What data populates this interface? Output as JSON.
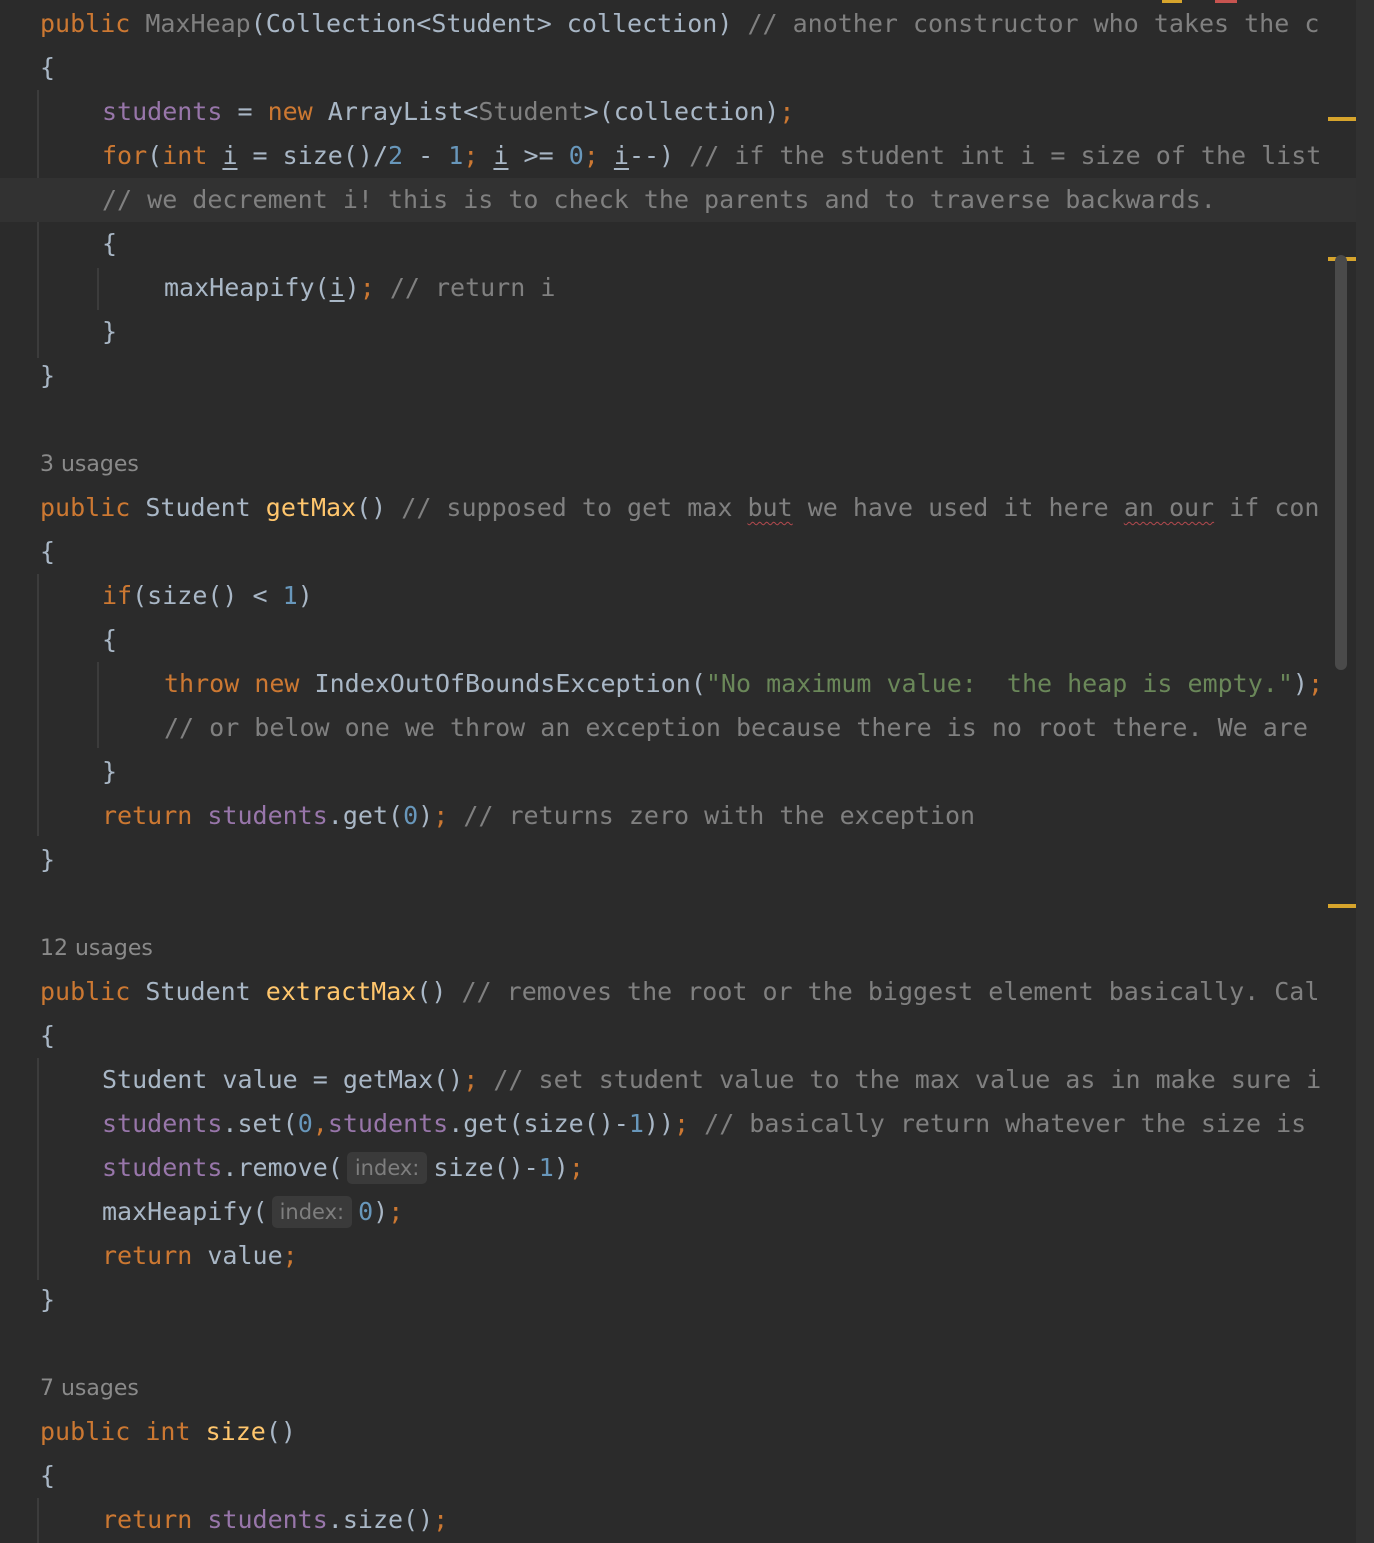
{
  "editor": {
    "colors": {
      "background": "#2b2b2b",
      "keyword": "#cc7832",
      "field": "#9876aa",
      "method": "#ffc66d",
      "number": "#6897bb",
      "string": "#6a8759",
      "comment": "#808080",
      "text": "#a9b7c6",
      "marker": "#d6a42c"
    },
    "usages": {
      "get_max": "3 usages",
      "extract_max": "12 usages",
      "size": "7 usages"
    },
    "hints": {
      "index": "index:"
    },
    "lines": {
      "l1": {
        "public": "public",
        "name": "MaxHeap",
        "params": "(Collection<Student> collection)",
        "comment": "// another constructor who takes the c"
      },
      "l2": {
        "brace": "{"
      },
      "l3": {
        "students": "students",
        "eq": " = ",
        "new": "new",
        "type": " ArrayList<",
        "generic": "Student",
        "rest": ">(collection)",
        "semi": ";"
      },
      "l4": {
        "for": "for",
        "open": "(",
        "int": "int",
        "i1": "i",
        "p1": " = size()/",
        "n2": "2",
        "p2": " - ",
        "n1": "1",
        "s1": ";",
        "i2": "i",
        "p3": " >= ",
        "n0": "0",
        "s2": ";",
        "i3": "i",
        "p4": "--) ",
        "comment": "// if the student int i = size of the list"
      },
      "l5": {
        "comment": "// we decrement i! this is to check the parents and to traverse backwards."
      },
      "l6": {
        "brace": "{"
      },
      "l7": {
        "call": "maxHeapify(",
        "i": "i",
        "close": ")",
        "semi": ";",
        "comment": "// return i"
      },
      "l8": {
        "brace": "}"
      },
      "l9": {
        "brace": "}"
      },
      "l10": {
        "public": "public",
        "type": "Student",
        "name": "getMax",
        "parens": "()",
        "c_a": "// supposed to get max",
        "c_but": "but",
        "c_b": "we have used it here",
        "c_anour": "an our",
        "c_c": "if con"
      },
      "l11": {
        "brace": "{"
      },
      "l12": {
        "if": "if",
        "p1": "(size() < ",
        "n1": "1",
        "p2": ")"
      },
      "l13": {
        "brace": "{"
      },
      "l14": {
        "throw": "throw",
        "new": "new",
        "cls": " IndexOutOfBoundsException(",
        "str": "\"No maximum value:  the heap is empty.\"",
        "close": ")",
        "semi": ";"
      },
      "l15": {
        "comment": "// or below one we throw an exception because there is no root there. We are"
      },
      "l16": {
        "brace": "}"
      },
      "l17": {
        "return": "return",
        "students": "students",
        "call": ".get(",
        "n0": "0",
        "close": ")",
        "semi": ";",
        "comment": "// returns zero with the exception"
      },
      "l18": {
        "brace": "}"
      },
      "l19": {
        "public": "public",
        "type": "Student",
        "name": "extractMax",
        "parens": "()",
        "comment": "// removes the root or the biggest element basically. Cal"
      },
      "l20": {
        "brace": "{"
      },
      "l21": {
        "decl": "Student value = getMax()",
        "semi": ";",
        "comment": "// set student value to the max value as in make sure i"
      },
      "l22": {
        "students1": "students",
        "set": ".set(",
        "n0": "0",
        "comma": ",",
        "students2": "students",
        "get": ".get(size()-",
        "n1": "1",
        "close": "))",
        "semi": ";",
        "comment": "// basically return whatever the size is"
      },
      "l23": {
        "students": "students",
        "call": ".remove(",
        "arg": "size()-",
        "n1": "1",
        "close": ")",
        "semi": ";"
      },
      "l24": {
        "call": "maxHeapify(",
        "n0": "0",
        "close": ")",
        "semi": ";"
      },
      "l25": {
        "return": "return",
        "value": " value",
        "semi": ";"
      },
      "l26": {
        "brace": "}"
      },
      "l27": {
        "public": "public",
        "int": "int",
        "name": "size",
        "parens": "()"
      },
      "l28": {
        "brace": "{"
      },
      "l29": {
        "return": "return",
        "students": "students",
        "call": ".size()",
        "semi": ";"
      }
    }
  }
}
